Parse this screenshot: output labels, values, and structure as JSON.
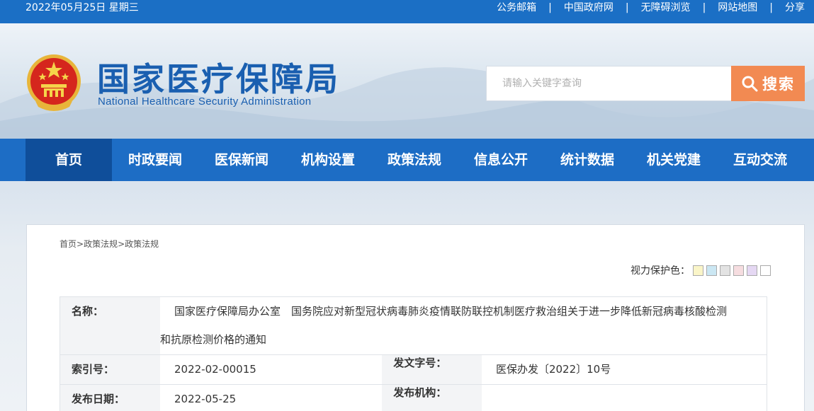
{
  "topbar": {
    "date": "2022年05月25日 星期三",
    "links": [
      "公务邮箱",
      "中国政府网",
      "无障碍浏览",
      "网站地图",
      "分享"
    ],
    "separator": "|"
  },
  "header": {
    "title_cn": "国家医疗保障局",
    "title_en": "National Healthcare Security Administration",
    "search_placeholder": "请输入关键字查询",
    "search_button": "搜索",
    "emblem_icon": "national-emblem-icon",
    "search_icon": "magnifier-icon"
  },
  "nav": {
    "items": [
      "首页",
      "时政要闻",
      "医保新闻",
      "机构设置",
      "政策法规",
      "信息公开",
      "统计数据",
      "机关党建",
      "互动交流"
    ],
    "active": "首页"
  },
  "breadcrumb": {
    "items": [
      "首页",
      "政策法规",
      "政策法规"
    ],
    "separator": ">"
  },
  "eye_protection": {
    "label": "视力保护色：",
    "swatches": [
      "#faf5c8",
      "#cbe7f3",
      "#e3e3e3",
      "#f6dde0",
      "#e5d8f3",
      "#ffffff"
    ]
  },
  "meta": {
    "name_label": "名称：",
    "name_line1": "国家医疗保障局办公室　国务院应对新型冠状病毒肺炎疫情联防联控机制医疗救治组关于进一步降低新冠病毒核酸检测",
    "name_line2": "和抗原检测价格的通知",
    "index_label": "索引号：",
    "index_value": "2022-02-00015",
    "docno_label": "发文字号：",
    "docno_value": "医保办发〔2022〕10号",
    "date_label": "发布日期：",
    "date_value": "2022-05-25",
    "org_label": "发布机构：",
    "org_value": ""
  },
  "colors": {
    "topbar": "#1b6fc5",
    "nav": "#1d6dc5",
    "nav_active": "#0f4e9a",
    "title": "#1a5fb0",
    "search_button": "#f28a52"
  }
}
